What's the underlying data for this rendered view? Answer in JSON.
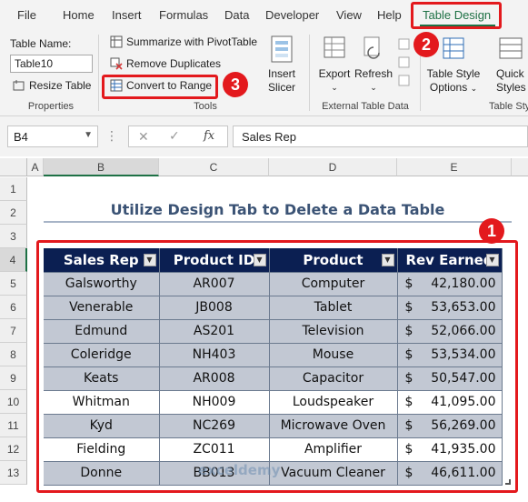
{
  "tabs": [
    "File",
    "Home",
    "Insert",
    "Formulas",
    "Data",
    "Developer",
    "View",
    "Help",
    "Table Design"
  ],
  "ribbon": {
    "properties": {
      "table_name_label": "Table Name:",
      "table_name_value": "Table10",
      "resize_label": "Resize Table",
      "group_label": "Properties"
    },
    "tools": {
      "summarize_label": "Summarize with PivotTable",
      "remove_dup_label": "Remove Duplicates",
      "convert_label": "Convert to Range",
      "insert_slicer_line1": "Insert",
      "insert_slicer_line2": "Slicer",
      "group_label": "Tools"
    },
    "external": {
      "export_label": "Export",
      "refresh_label": "Refresh",
      "group_label": "External Table Data"
    },
    "style": {
      "options_line1": "Table Style",
      "options_line2": "Options",
      "quick_line1": "Quick",
      "quick_line2": "Styles",
      "group_label": "Table Sty"
    }
  },
  "formula_bar": {
    "name_box": "B4",
    "fx": "fx",
    "content": "Sales Rep"
  },
  "columns": [
    "A",
    "B",
    "C",
    "D",
    "E"
  ],
  "rows": [
    "1",
    "2",
    "3",
    "4",
    "5",
    "6",
    "7",
    "8",
    "9",
    "10",
    "11",
    "12",
    "13"
  ],
  "sheet": {
    "title": "Utilize Design Tab to Delete a Data Table",
    "headers": [
      "Sales Rep",
      "Product ID",
      "Product",
      "Rev Earned"
    ],
    "currency_symbol": "$",
    "records": [
      {
        "rep": "Galsworthy",
        "id": "AR007",
        "product": "Computer",
        "rev": "42,180.00"
      },
      {
        "rep": "Venerable",
        "id": "JB008",
        "product": "Tablet",
        "rev": "53,653.00"
      },
      {
        "rep": "Edmund",
        "id": "AS201",
        "product": "Television",
        "rev": "52,066.00"
      },
      {
        "rep": "Coleridge",
        "id": "NH403",
        "product": "Mouse",
        "rev": "53,534.00"
      },
      {
        "rep": "Keats",
        "id": "AR008",
        "product": "Capacitor",
        "rev": "50,547.00"
      },
      {
        "rep": "Whitman",
        "id": "NH009",
        "product": "Loudspeaker",
        "rev": "41,095.00"
      },
      {
        "rep": "Kyd",
        "id": "NC269",
        "product": "Microwave Oven",
        "rev": "56,269.00"
      },
      {
        "rep": "Fielding",
        "id": "ZC011",
        "product": "Amplifier",
        "rev": "41,935.00"
      },
      {
        "rep": "Donne",
        "id": "BB013",
        "product": "Vacuum Cleaner",
        "rev": "46,611.00"
      }
    ]
  },
  "callouts": [
    "1",
    "2",
    "3"
  ],
  "watermark": "exceldemy",
  "colors": {
    "accent_red": "#e3191d",
    "header_navy": "#0b1f52",
    "band_gray": "#c2c8d3",
    "excel_green": "#1e7145"
  }
}
